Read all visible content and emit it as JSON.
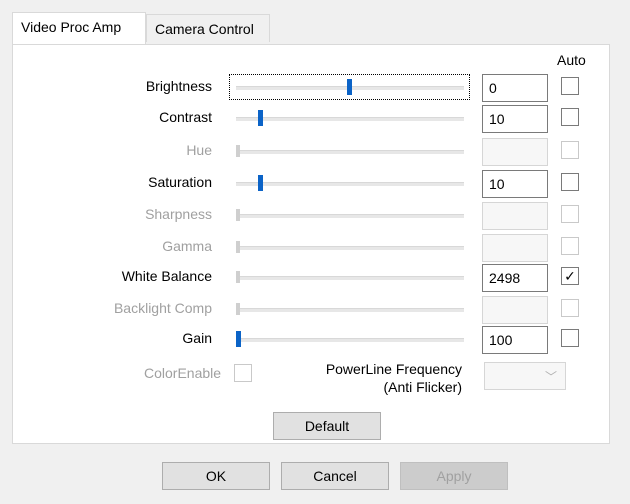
{
  "tabs": [
    {
      "label": "Video Proc Amp",
      "active": true
    },
    {
      "label": "Camera Control",
      "active": false
    }
  ],
  "auto_header": "Auto",
  "properties": [
    {
      "label": "Brightness",
      "value": "0",
      "slider_fraction": 0.5,
      "enabled": true,
      "auto": false,
      "focused": true
    },
    {
      "label": "Contrast",
      "value": "10",
      "slider_fraction": 0.1,
      "enabled": true,
      "auto": false
    },
    {
      "label": "Hue",
      "value": "",
      "slider_fraction": 0.0,
      "enabled": false,
      "auto": false
    },
    {
      "label": "Saturation",
      "value": "10",
      "slider_fraction": 0.1,
      "enabled": true,
      "auto": false
    },
    {
      "label": "Sharpness",
      "value": "",
      "slider_fraction": 0.0,
      "enabled": false,
      "auto": false
    },
    {
      "label": "Gamma",
      "value": "",
      "slider_fraction": 0.0,
      "enabled": false,
      "auto": false
    },
    {
      "label": "White Balance",
      "value": "2498",
      "slider_fraction": 0.0,
      "enabled": true,
      "auto": true,
      "slider_enabled": false
    },
    {
      "label": "Backlight Comp",
      "value": "",
      "slider_fraction": 0.0,
      "enabled": false,
      "auto": false
    },
    {
      "label": "Gain",
      "value": "100",
      "slider_fraction": 0.0,
      "enabled": true,
      "auto": false
    }
  ],
  "color_enable": {
    "label": "ColorEnable",
    "checked": false
  },
  "powerline": {
    "label_line1": "PowerLine Frequency",
    "label_line2": "(Anti Flicker)",
    "value": ""
  },
  "buttons": {
    "default": "Default",
    "ok": "OK",
    "cancel": "Cancel",
    "apply": "Apply"
  },
  "checkmark": "✓",
  "combo_arrow": "﹀"
}
